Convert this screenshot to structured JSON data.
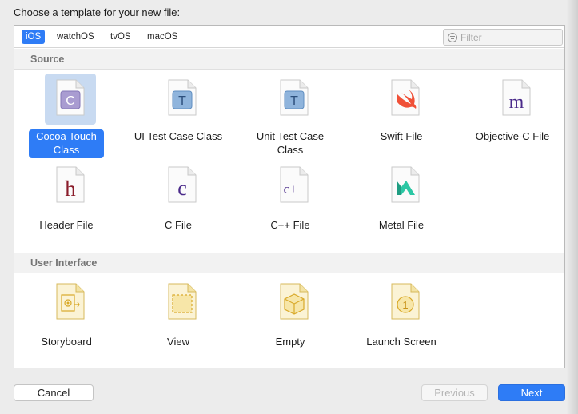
{
  "dialog": {
    "prompt": "Choose a template for your new file:"
  },
  "platform_tabs": [
    {
      "label": "iOS",
      "active": true
    },
    {
      "label": "watchOS",
      "active": false
    },
    {
      "label": "tvOS",
      "active": false
    },
    {
      "label": "macOS",
      "active": false
    }
  ],
  "filter": {
    "placeholder": "Filter",
    "value": "",
    "icon": "filter-icon"
  },
  "sections": {
    "source": {
      "title": "Source",
      "items": [
        {
          "label": "Cocoa Touch Class",
          "glyph": "C",
          "icon": "cocoa-touch-class-icon",
          "selected": true
        },
        {
          "label": "UI Test Case Class",
          "glyph": "T",
          "icon": "ui-test-case-class-icon",
          "selected": false
        },
        {
          "label": "Unit Test Case Class",
          "glyph": "T",
          "icon": "unit-test-case-class-icon",
          "selected": false
        },
        {
          "label": "Swift File",
          "glyph": "",
          "icon": "swift-file-icon",
          "selected": false
        },
        {
          "label": "Objective-C File",
          "glyph": "m",
          "icon": "objective-c-file-icon",
          "selected": false
        },
        {
          "label": "Header File",
          "glyph": "h",
          "icon": "header-file-icon",
          "selected": false
        },
        {
          "label": "C File",
          "glyph": "c",
          "icon": "c-file-icon",
          "selected": false
        },
        {
          "label": "C++ File",
          "glyph": "c++",
          "icon": "cpp-file-icon",
          "selected": false
        },
        {
          "label": "Metal File",
          "glyph": "",
          "icon": "metal-file-icon",
          "selected": false
        }
      ]
    },
    "user_interface": {
      "title": "User Interface",
      "items": [
        {
          "label": "Storyboard",
          "glyph": "",
          "icon": "storyboard-icon",
          "selected": false
        },
        {
          "label": "View",
          "glyph": "",
          "icon": "view-icon",
          "selected": false
        },
        {
          "label": "Empty",
          "glyph": "",
          "icon": "empty-icon",
          "selected": false
        },
        {
          "label": "Launch Screen",
          "glyph": "1",
          "icon": "launch-screen-icon",
          "selected": false
        }
      ]
    }
  },
  "buttons": {
    "cancel": "Cancel",
    "previous": "Previous",
    "next": "Next"
  },
  "colors": {
    "accent": "#2e7cf6",
    "selection_bg": "#c8daf1",
    "objc_purple": "#4a2a8a",
    "header_red": "#8a1c2a",
    "swift_orange": "#f05138",
    "metal_teal": "#2cc7a4",
    "test_blue": "#6d9bcb",
    "storyboard_yellow": "#f3cf5a"
  }
}
